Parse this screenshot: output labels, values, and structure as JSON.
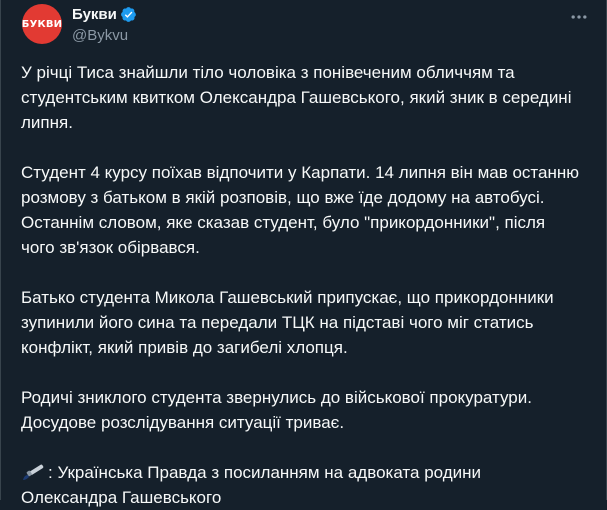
{
  "account": {
    "avatar_text": "БУКВИ",
    "avatar_color": "#e23a33",
    "display_name": "Букви",
    "handle": "@Bykvu",
    "verified": true,
    "verified_color": "#1d9bf0"
  },
  "menu": {
    "icon": "more-horizontal-icon"
  },
  "tweet": {
    "paragraphs": [
      "У річці Тиса знайшли тіло чоловіка з понівеченим обличчям та студентським квитком Олександра Гашевського, який зник в середині липня.",
      "Студент 4 курсу поїхав відпочити у Карпати. 14 липня він мав останню розмову з батьком в якій розповів, що вже їде додому на автобусі. Останнім словом, яке сказав студент, було \"прикордонники\", після чого зв'язок обірвався.",
      "Батько студента Микола Гашевський припускає, що прикордонники зупинили його сина та передали ТЦК на підставі чого міг статись конфлікт, який привів до загибелі хлопця.",
      "Родичі зниклого студента звернулись до військової прокуратури. Досудове розслідування ситуації триває."
    ],
    "source_icon": "paintbrush-icon",
    "source_text": ": Українська Правда з посиланням на адвоката родини Олександра Гашевського"
  }
}
